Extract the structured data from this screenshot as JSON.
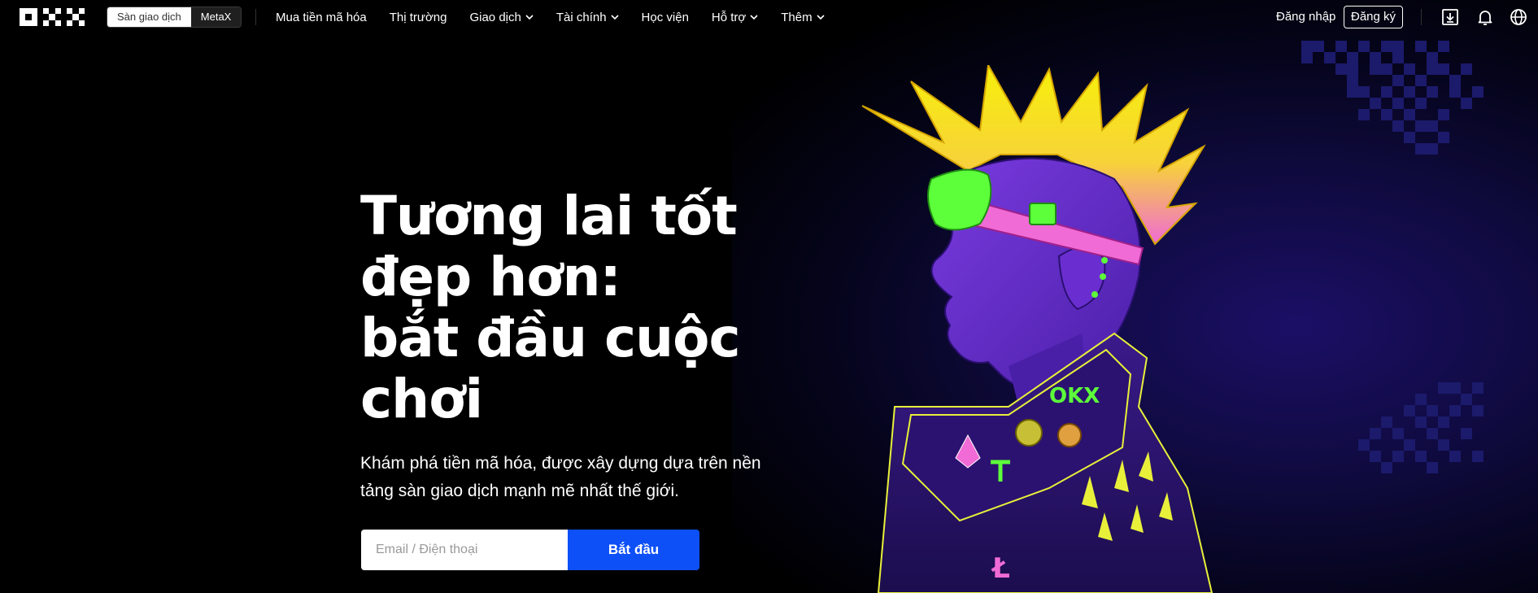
{
  "header": {
    "logo_name": "OKX",
    "mode_switch": {
      "exchange_label": "Sàn giao dịch",
      "wallet_label": "MetaX"
    },
    "nav": [
      {
        "label": "Mua tiền mã hóa",
        "has_dropdown": false
      },
      {
        "label": "Thị trường",
        "has_dropdown": false
      },
      {
        "label": "Giao dịch",
        "has_dropdown": true
      },
      {
        "label": "Tài chính",
        "has_dropdown": true
      },
      {
        "label": "Học viện",
        "has_dropdown": false
      },
      {
        "label": "Hỗ trợ",
        "has_dropdown": true
      },
      {
        "label": "Thêm",
        "has_dropdown": true
      }
    ],
    "login_label": "Đăng nhập",
    "register_label": "Đăng ký",
    "icons": [
      "download-icon",
      "bell-icon",
      "globe-icon"
    ]
  },
  "hero": {
    "title_lines": [
      "Tương lai tốt",
      "đẹp hơn:",
      "bắt đầu cuộc",
      "chơi"
    ],
    "subtitle": "Khám phá tiền mã hóa, được xây dựng dựa trên nền tảng sàn giao dịch mạnh mẽ nhất thế giới.",
    "input_placeholder": "Email / Điện thoại",
    "cta_label": "Bắt đầu"
  },
  "colors": {
    "background": "#000000",
    "cta_blue": "#0d50f7",
    "art_purple": "#6b2fd1",
    "hair_yellow": "#f7f00a",
    "goggle_green": "#5cff3a",
    "band_pink": "#f06bd5"
  },
  "artwork": {
    "badge_text": "OKX"
  }
}
